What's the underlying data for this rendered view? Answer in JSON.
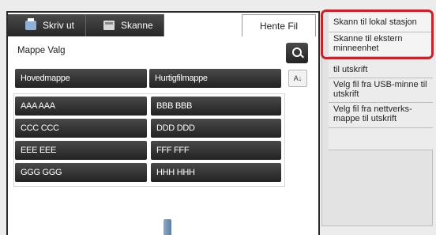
{
  "tabs": [
    {
      "label": "Skriv ut",
      "icon": "print-icon"
    },
    {
      "label": "Skanne",
      "icon": "scan-icon"
    },
    {
      "label": "Hente Fil"
    }
  ],
  "folder_select": {
    "label": "Mappe Valg",
    "main_folder": "Hovedmappe",
    "quick_folder": "Hurtigfilmappe",
    "sort_label": "A↓"
  },
  "folders": [
    "AAA AAA",
    "BBB BBB",
    "CCC CCC",
    "DDD DDD",
    "EEE EEE",
    "FFF FFF",
    "GGG GGG",
    "HHH HHH"
  ],
  "side_menu": [
    "Skann til lokal stasjon",
    "Skanne til ekstern minneenhet",
    "til utskrift",
    "Velg fil fra USB-minne til utskrift",
    "Velg fil fra nettverks-mappe til utskrift",
    ""
  ],
  "colors": {
    "highlight": "#c0262d"
  }
}
